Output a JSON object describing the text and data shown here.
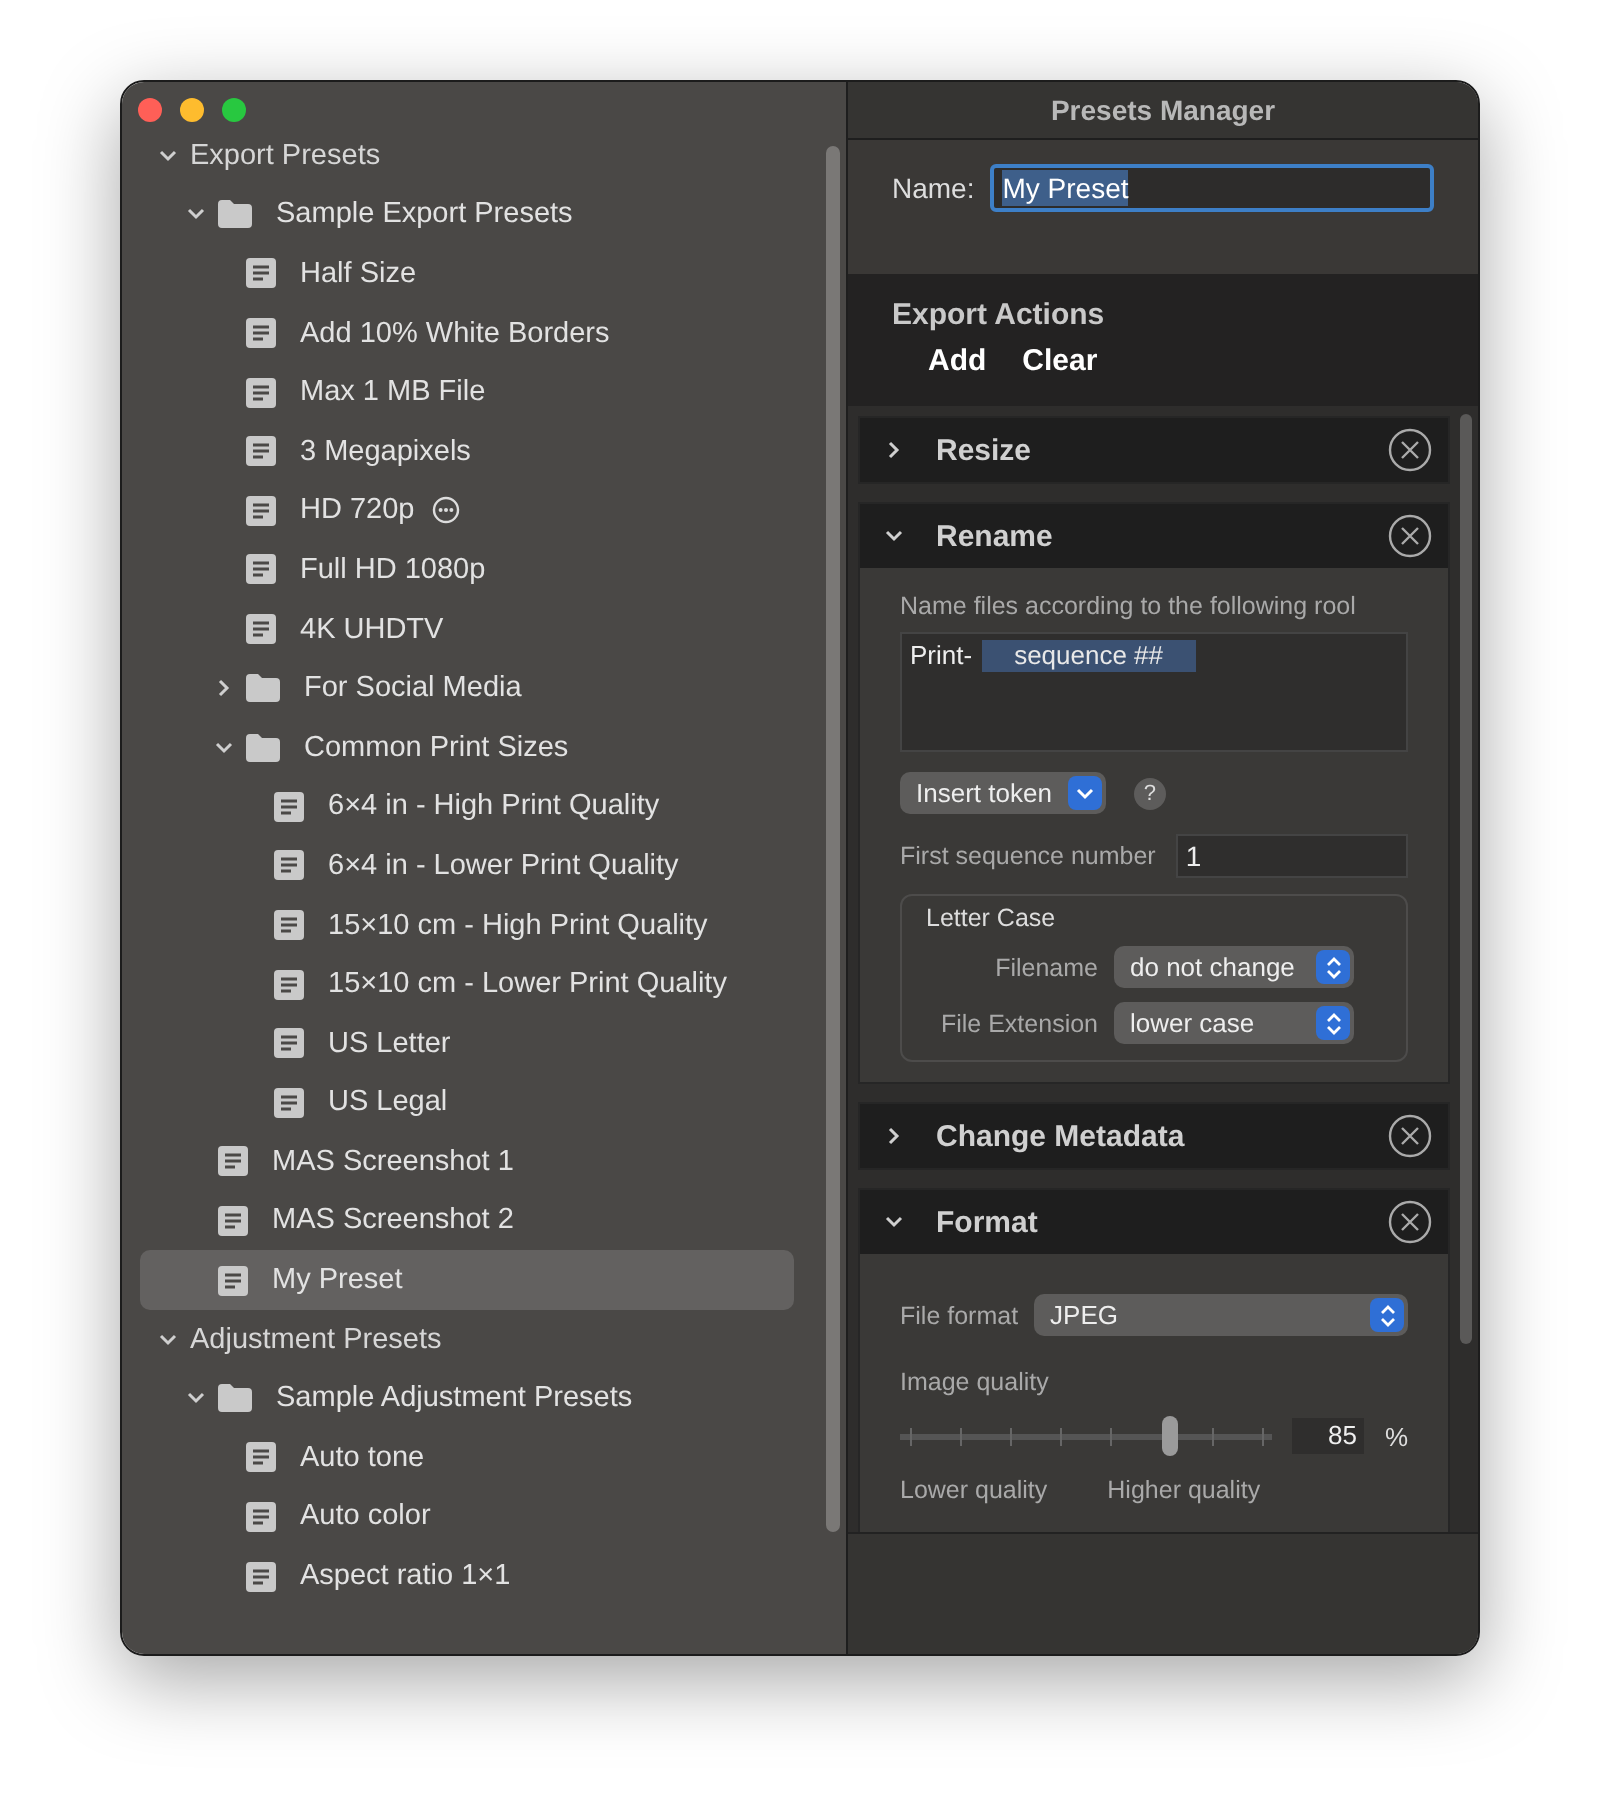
{
  "window": {
    "title": "Presets Manager"
  },
  "sidebar": {
    "tree": [
      {
        "label": "Export Presets",
        "kind": "group",
        "expanded": true,
        "selected": false,
        "more": false,
        "children": [
          {
            "label": "Sample Export Presets",
            "kind": "folder",
            "expanded": true,
            "selected": false,
            "more": false,
            "children": [
              {
                "label": "Half Size",
                "kind": "preset",
                "selected": false,
                "more": false
              },
              {
                "label": "Add 10% White Borders",
                "kind": "preset",
                "selected": false,
                "more": false
              },
              {
                "label": "Max 1 MB File",
                "kind": "preset",
                "selected": false,
                "more": false
              },
              {
                "label": "3 Megapixels",
                "kind": "preset",
                "selected": false,
                "more": false
              },
              {
                "label": "HD 720p",
                "kind": "preset",
                "selected": false,
                "more": true
              },
              {
                "label": "Full HD 1080p",
                "kind": "preset",
                "selected": false,
                "more": false
              },
              {
                "label": "4K UHDTV",
                "kind": "preset",
                "selected": false,
                "more": false
              },
              {
                "label": "For Social Media",
                "kind": "folder",
                "expanded": false,
                "selected": false,
                "more": false
              },
              {
                "label": "Common Print Sizes",
                "kind": "folder",
                "expanded": true,
                "selected": false,
                "more": false,
                "children": [
                  {
                    "label": "6×4 in - High Print Quality",
                    "kind": "preset",
                    "selected": false,
                    "more": false
                  },
                  {
                    "label": "6×4 in - Lower Print Quality",
                    "kind": "preset",
                    "selected": false,
                    "more": false
                  },
                  {
                    "label": "15×10 cm - High Print Quality",
                    "kind": "preset",
                    "selected": false,
                    "more": false
                  },
                  {
                    "label": "15×10 cm - Lower Print Quality",
                    "kind": "preset",
                    "selected": false,
                    "more": false
                  },
                  {
                    "label": "US Letter",
                    "kind": "preset",
                    "selected": false,
                    "more": false
                  },
                  {
                    "label": "US Legal",
                    "kind": "preset",
                    "selected": false,
                    "more": false
                  }
                ]
              }
            ]
          },
          {
            "label": "MAS Screenshot 1",
            "kind": "preset",
            "selected": false,
            "more": false
          },
          {
            "label": "MAS Screenshot 2",
            "kind": "preset",
            "selected": false,
            "more": false
          },
          {
            "label": "My Preset",
            "kind": "preset",
            "selected": true,
            "more": false
          }
        ]
      },
      {
        "label": "Adjustment Presets",
        "kind": "group",
        "expanded": true,
        "selected": false,
        "more": false,
        "children": [
          {
            "label": "Sample Adjustment Presets",
            "kind": "folder",
            "expanded": true,
            "selected": false,
            "more": false,
            "children": [
              {
                "label": "Auto tone",
                "kind": "preset",
                "selected": false,
                "more": false
              },
              {
                "label": "Auto color",
                "kind": "preset",
                "selected": false,
                "more": false
              },
              {
                "label": "Aspect ratio 1×1",
                "kind": "preset",
                "selected": false,
                "more": false
              }
            ]
          }
        ]
      }
    ]
  },
  "name_field": {
    "label": "Name:",
    "value": "My Preset"
  },
  "export_actions": {
    "title": "Export Actions",
    "buttons": [
      "Add",
      "Clear"
    ],
    "sections": [
      {
        "title": "Resize",
        "expanded": false
      },
      {
        "kind": "rename",
        "title": "Rename",
        "expanded": true,
        "rule_label": "Name files according to the following rool",
        "rule_text": "Print-",
        "rule_token": "sequence ##",
        "insert_token": "Insert token",
        "help": "?",
        "first_number_label": "First sequence number",
        "first_number": "1",
        "letter_case": {
          "title": "Letter Case",
          "rows": [
            {
              "label": "Filename",
              "value": "do not change"
            },
            {
              "label": "File Extension",
              "value": "lower case"
            }
          ]
        }
      },
      {
        "title": "Change Metadata",
        "expanded": false
      },
      {
        "kind": "format",
        "title": "Format",
        "expanded": true,
        "file_format_label": "File format",
        "file_format": "JPEG",
        "quality_label": "Image quality",
        "quality": {
          "level": 0.74,
          "reading": "85",
          "unit": "%"
        },
        "low_label": "Lower quality",
        "high_label": "Higher quality"
      }
    ]
  }
}
